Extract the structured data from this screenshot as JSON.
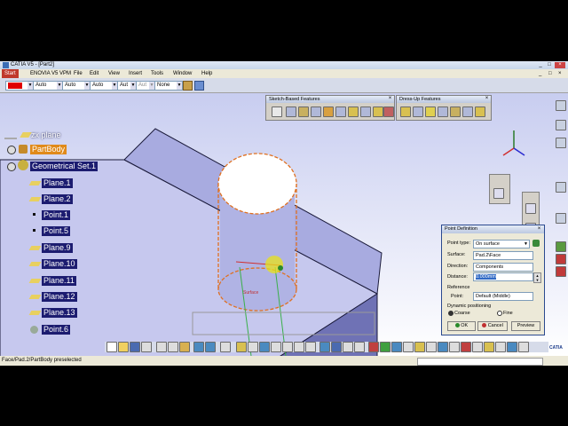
{
  "window": {
    "title": "CATIA V5 - [Part2]",
    "controls": [
      "_",
      "□",
      "×"
    ]
  },
  "menubar": {
    "items": [
      "Start",
      "ENOVIA V5 VPM",
      "File",
      "Edit",
      "View",
      "Insert",
      "Tools",
      "Window",
      "Help"
    ],
    "right_controls": [
      "_",
      "□",
      "×"
    ]
  },
  "toolbar": {
    "color_combo": "",
    "combo1": "Auto",
    "combo2": "Auto",
    "combo3": "Auto",
    "combo4": "Aut",
    "combo5": "Aut",
    "combo6": "None",
    "accent_red": "#e00000"
  },
  "tree": {
    "items": [
      {
        "label": "zx plane",
        "icon": "plane-icon"
      },
      {
        "label": "PartBody",
        "icon": "gear-icon"
      },
      {
        "label": "Geometrical Set.1",
        "icon": "geometrical-set-icon"
      },
      {
        "label": "Plane.1",
        "icon": "plane-icon"
      },
      {
        "label": "Plane.2",
        "icon": "plane-icon"
      },
      {
        "label": "Point.1",
        "icon": "point-icon"
      },
      {
        "label": "Point.5",
        "icon": "point-icon"
      },
      {
        "label": "Plane.9",
        "icon": "plane-icon"
      },
      {
        "label": "Plane.10",
        "icon": "plane-icon"
      },
      {
        "label": "Plane.11",
        "icon": "plane-icon"
      },
      {
        "label": "Plane.12",
        "icon": "plane-icon"
      },
      {
        "label": "Plane.13",
        "icon": "plane-icon"
      },
      {
        "label": "Point.6",
        "icon": "point-icon"
      }
    ]
  },
  "toolbars": {
    "sketch_based": "Sketch-Based Features",
    "dress_up": "Dress-Up Features"
  },
  "viewport": {
    "surface_label": "Surface"
  },
  "dialog": {
    "title": "Point Definition",
    "point_type_label": "Point type:",
    "point_type_value": "On surface",
    "surface_label": "Surface:",
    "surface_value": "Pad.2\\Face",
    "direction_label": "Direction:",
    "direction_value": "Components",
    "distance_label": "Distance:",
    "distance_value": "0.000mm",
    "reference_label": "Reference",
    "ref_point_label": "Point:",
    "ref_point_value": "Default (Middle)",
    "dynamic_label": "Dynamic positioning",
    "coarse_label": "Coarse",
    "fine_label": "Fine",
    "ok_label": "OK",
    "cancel_label": "Cancel",
    "preview_label": "Preview"
  },
  "statusbar": {
    "text": "Face/Pad.2/PartBody preselected"
  },
  "logo": {
    "text": "CATIA"
  }
}
